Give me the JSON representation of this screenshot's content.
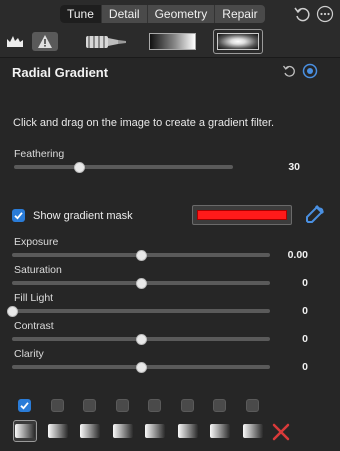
{
  "tabs": [
    {
      "label": "Tune",
      "active": true
    },
    {
      "label": "Detail",
      "active": false
    },
    {
      "label": "Geometry",
      "active": false
    },
    {
      "label": "Repair",
      "active": false
    }
  ],
  "panel": {
    "title": "Radial Gradient",
    "hint": "Click and drag on the image to create a gradient filter."
  },
  "feathering": {
    "label": "Feathering",
    "value": "30",
    "level": 0.3
  },
  "show_mask": {
    "label": "Show gradient mask",
    "checked": true,
    "color": "#ff1a1a"
  },
  "sliders": [
    {
      "label": "Exposure",
      "value": "0.00",
      "level": 0.5
    },
    {
      "label": "Saturation",
      "value": "0",
      "level": 0.5
    },
    {
      "label": "Fill Light",
      "value": "0",
      "level": 0.0
    },
    {
      "label": "Contrast",
      "value": "0",
      "level": 0.5
    },
    {
      "label": "Clarity",
      "value": "0",
      "level": 0.5
    }
  ],
  "gradient_slots": {
    "checked": [
      true,
      false,
      false,
      false,
      false,
      false,
      false,
      false
    ],
    "selected_index": 0
  },
  "colors": {
    "accent": "#2a7cd8",
    "delete": "#d93a3a"
  }
}
